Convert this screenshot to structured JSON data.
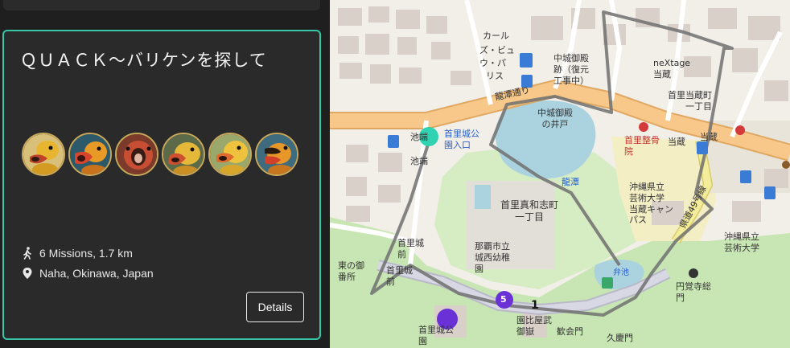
{
  "card": {
    "title": "ＱＵＡＣＫ～バリケンを探して",
    "missions": "6 Missions, 1.7 km",
    "location": "Naha, Okinawa, Japan",
    "details_label": "Details"
  },
  "avatars": [
    "duck-avatar-1",
    "duck-avatar-2",
    "duck-avatar-3",
    "duck-avatar-4",
    "duck-avatar-5",
    "duck-avatar-6"
  ],
  "map": {
    "labels": {
      "carls": "カール",
      "zubyu": "ズ・ビュ",
      "upa": "ウ・パ",
      "ris": "リス",
      "gotenato": "中城御殿\n跡（復元\n工事中）",
      "nextage": "neXtage\n当蔵",
      "tonokura": "首里当蔵町\n一丁目",
      "ryutan_dori": "龍潭通り",
      "ike": "池端",
      "shuri_koen": "首里城公\n園入口",
      "gotenido": "中城御殿\nの井戸",
      "shuri_seikotsu": "首里整骨\n院",
      "tokura_stop": "当蔵",
      "tokura_stop2": "当蔵",
      "ikehata2": "池端",
      "ryutan": "龍潭",
      "mawashi": "首里真和志町\n一丁目",
      "geidai": "沖縄県立\n芸術大学\n当蔵キャン\nパス",
      "route49": "県道49号線",
      "shuricastle_mae": "首里城\n前",
      "shuricastle_mae2": "首里城\n前",
      "higashi": "東の御\n番所",
      "kindergarten": "那覇市立\n城西幼稚\n園",
      "geidai2": "沖縄県立\n芸術大学",
      "enkakuji": "円覚寺総\n門",
      "sotoike": "園比屋武\n御嶽",
      "kankaimon": "歓会門",
      "kyukeimon": "久慶門",
      "shurijo_koen": "首里城公\n園",
      "ike_pond": "弁池"
    },
    "marker_5": "5",
    "marker_1": "1",
    "colors": {
      "route": "#707070",
      "teal_marker": "#2fd3b1",
      "purple_marker": "#6a32d6",
      "road": "#f7c88a"
    }
  }
}
